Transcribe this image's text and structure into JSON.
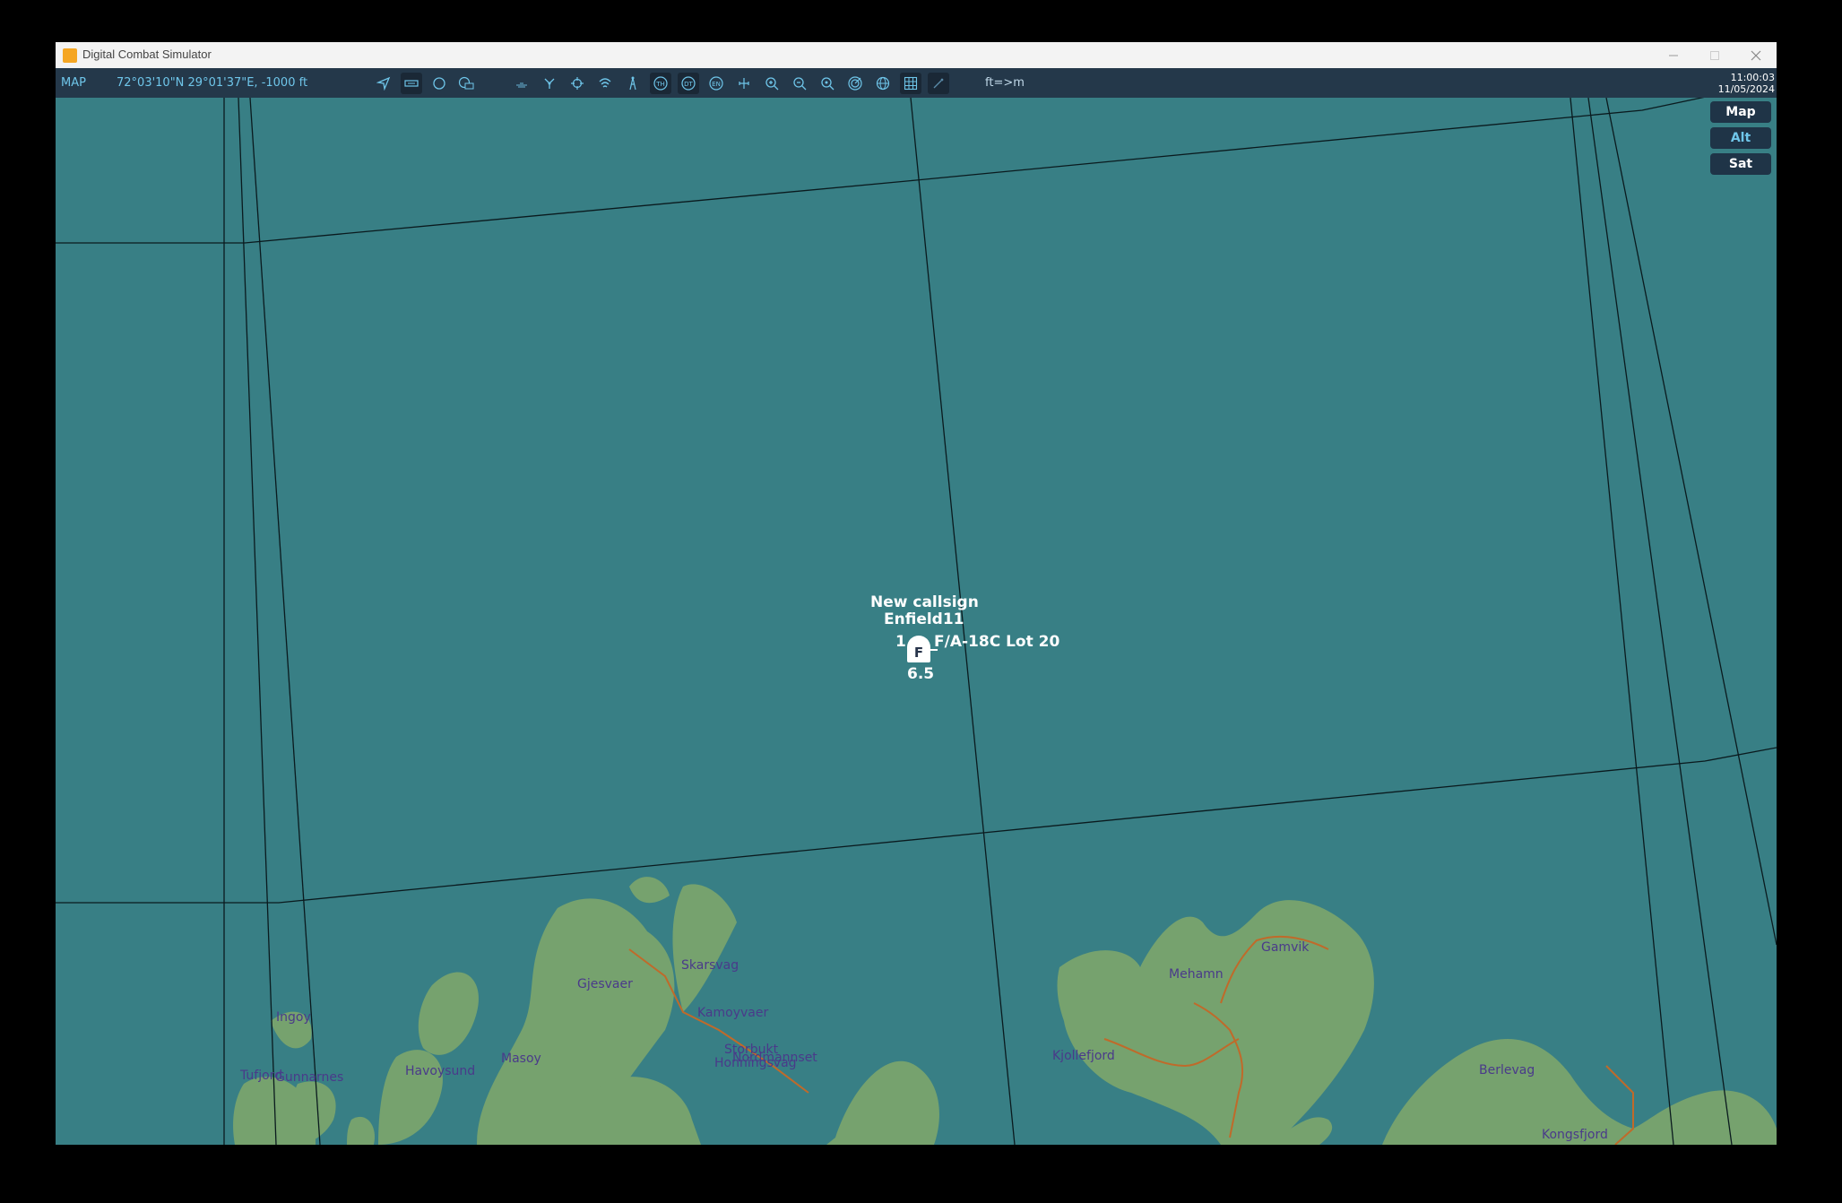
{
  "window": {
    "title": "Digital Combat Simulator"
  },
  "toolbar": {
    "mode_label": "MAP",
    "coordinates": "72°03'10\"N 29°01'37\"E, -1000 ft",
    "units_toggle": "ft=>m",
    "time": "11:00:03",
    "date": "11/05/2024",
    "icons": [
      "navigate-icon",
      "unit-label-icon",
      "circle-icon",
      "chat-icon",
      "airbase-icon",
      "route-icon",
      "target-icon",
      "radio-icon",
      "tower-icon",
      "threat-ring-icon",
      "detection-ring-icon",
      "engagement-ring-icon",
      "ruler-icon",
      "zoom-in-icon",
      "zoom-out-icon",
      "zoom-fit-icon",
      "radar-icon",
      "globe-icon",
      "grid-icon",
      "pencil-icon"
    ]
  },
  "layers": {
    "map": "Map",
    "alt": "Alt",
    "sat": "Sat"
  },
  "unit": {
    "name": "New callsign",
    "callsign": "Enfield11",
    "count": "1",
    "type": "F/A-18C Lot 20",
    "symbol": "F",
    "altitude_label": "6.5"
  },
  "places": [
    "Gamvik",
    "Mehamn",
    "Skarsvag",
    "Gjesvaer",
    "Kamoyvaer",
    "Ingoy",
    "Storbukt",
    "Honningsvag",
    "Nordmannset",
    "Kjollefjord",
    "Masoy",
    "Havoysund",
    "Tufjord",
    "Gunnarnes",
    "Berlevag",
    "Kongsfjord"
  ],
  "colors": {
    "sea": "#387f85",
    "land": "#76a26e",
    "toolbar": "#24384a",
    "accent": "#6fc6ea",
    "road": "#c06a2a"
  }
}
